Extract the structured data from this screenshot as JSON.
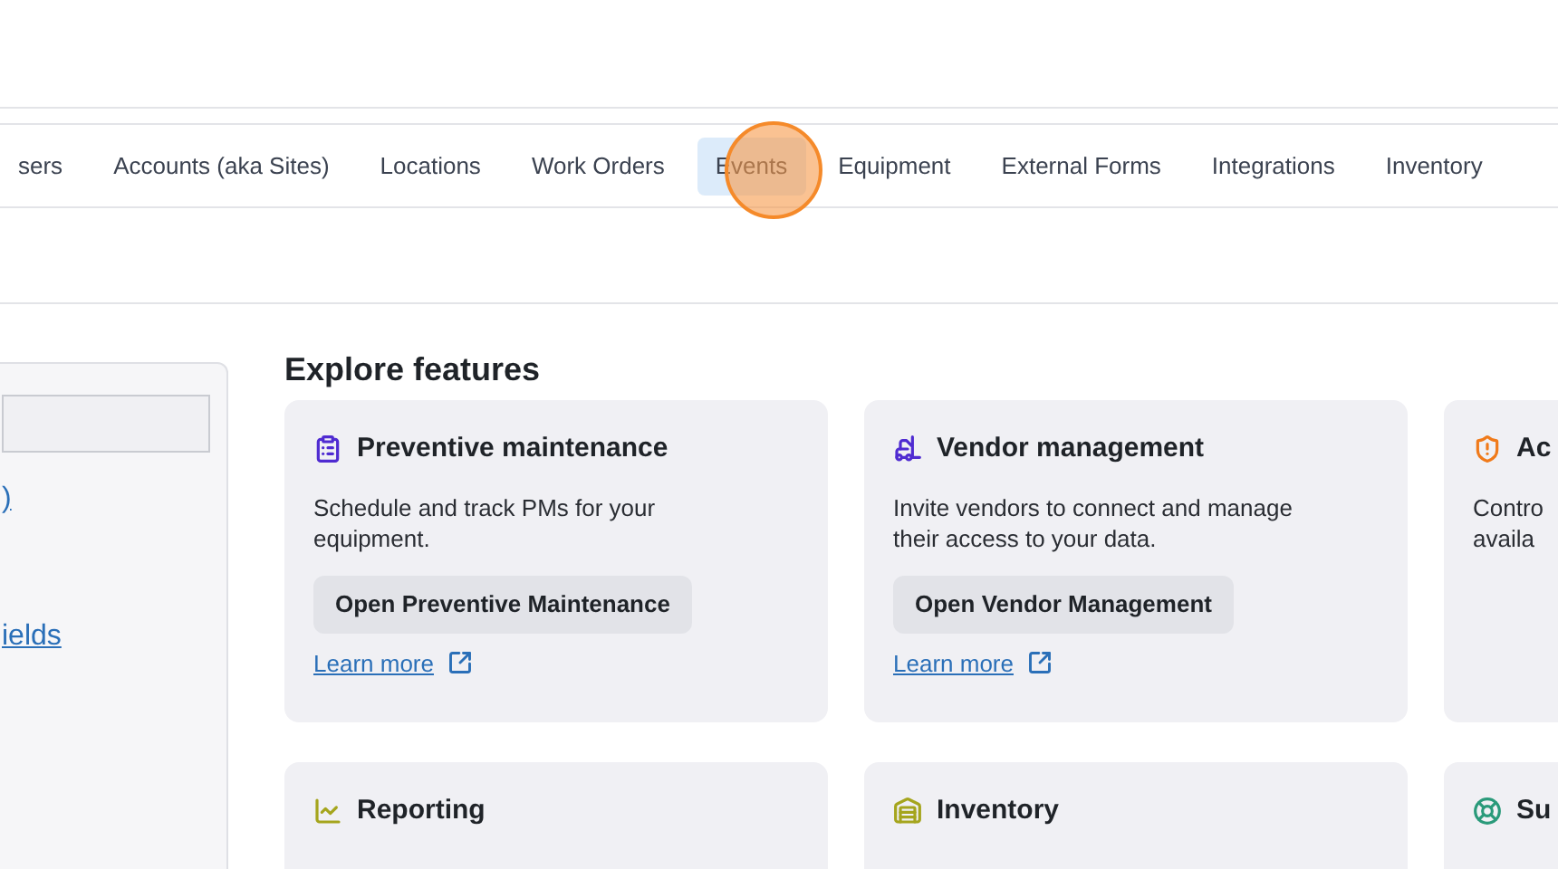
{
  "tabs": [
    {
      "label": "sers",
      "selected": false
    },
    {
      "label": "Accounts (aka Sites)",
      "selected": false
    },
    {
      "label": "Locations",
      "selected": false
    },
    {
      "label": "Work Orders",
      "selected": false
    },
    {
      "label": "Events",
      "selected": true
    },
    {
      "label": "Equipment",
      "selected": false
    },
    {
      "label": "External Forms",
      "selected": false
    },
    {
      "label": "Integrations",
      "selected": false
    },
    {
      "label": "Inventory",
      "selected": false
    }
  ],
  "sidebar": {
    "links": [
      ")",
      "ields"
    ]
  },
  "explore": {
    "title": "Explore features",
    "cards": [
      {
        "kind": "clipboard",
        "title": "Preventive maintenance",
        "description": "Schedule and track PMs for your equipment.",
        "button": "Open Preventive Maintenance",
        "link": "Learn more"
      },
      {
        "kind": "vendor",
        "title": "Vendor management",
        "description": "Invite vendors to connect and manage their access to your data.",
        "button": "Open Vendor Management",
        "link": "Learn more"
      },
      {
        "kind": "shield",
        "title": "Ac",
        "description_lines": [
          "Contro",
          "availa"
        ]
      },
      {
        "kind": "chart",
        "title": "Reporting"
      },
      {
        "kind": "inventory",
        "title": "Inventory"
      },
      {
        "kind": "lifebuoy",
        "title": "Su"
      }
    ]
  }
}
